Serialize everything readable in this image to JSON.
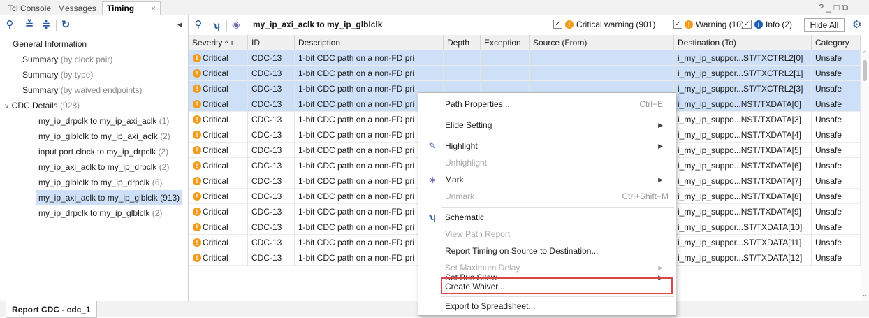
{
  "tabs": [
    {
      "label": "Tcl Console"
    },
    {
      "label": "Messages"
    },
    {
      "label": "Timing"
    }
  ],
  "window_controls": "? _ □ ⧉",
  "left_nav": {
    "general": "General Information",
    "summary1": {
      "main": "Summary",
      "muted": "(by clock pair)"
    },
    "summary2": {
      "main": "Summary",
      "muted": "(by type)"
    },
    "summary3": {
      "main": "Summary",
      "muted": "(by waived endpoints)"
    },
    "cdc": {
      "main": "CDC Details",
      "muted": "(928)"
    },
    "items": [
      {
        "main": "my_ip_drpclk to my_ip_axi_aclk",
        "muted": "(1)"
      },
      {
        "main": "my_ip_glblclk to my_ip_axi_aclk",
        "muted": "(2)"
      },
      {
        "main": "input port clock to my_ip_drpclk",
        "muted": "(2)"
      },
      {
        "main": "my_ip_axi_aclk to my_ip_drpclk",
        "muted": "(2)"
      },
      {
        "main": "my_ip_glblclk to my_ip_drpclk",
        "muted": "(6)"
      },
      {
        "main": "my_ip_axi_aclk to my_ip_glblclk",
        "muted": "(913)"
      },
      {
        "main": "my_ip_drpclk to my_ip_glblclk",
        "muted": "(2)"
      }
    ]
  },
  "right_toolbar": {
    "path_title": "my_ip_axi_aclk to my_ip_glblclk",
    "critical_label": "Critical warning (901)",
    "warning_label": "Warning (10)",
    "info_label": "Info (2)",
    "hide_all": "Hide All",
    "checked": "✓"
  },
  "table": {
    "headers": {
      "severity": "Severity",
      "sort": "^ 1",
      "id": "ID",
      "description": "Description",
      "depth": "Depth",
      "exception": "Exception",
      "source": "Source (From)",
      "destination": "Destination (To)",
      "category": "Category"
    },
    "rows": [
      {
        "severity": "Critical",
        "id": "CDC-13",
        "description": "1-bit CDC path on a non-FD pri",
        "destination": "i_my_ip_suppor...ST/TXCTRL2[0]",
        "category": "Unsafe",
        "selected": true
      },
      {
        "severity": "Critical",
        "id": "CDC-13",
        "description": "1-bit CDC path on a non-FD pri",
        "destination": "i_my_ip_suppor...ST/TXCTRL2[1]",
        "category": "Unsafe",
        "selected": true
      },
      {
        "severity": "Critical",
        "id": "CDC-13",
        "description": "1-bit CDC path on a non-FD pri",
        "destination": "i_my_ip_suppor...ST/TXCTRL2[3]",
        "category": "Unsafe",
        "selected": true
      },
      {
        "severity": "Critical",
        "id": "CDC-13",
        "description": "1-bit CDC path on a non-FD pri",
        "destination": "i_my_ip_suppo...NST/TXDATA[0]",
        "category": "Unsafe",
        "selected": true
      },
      {
        "severity": "Critical",
        "id": "CDC-13",
        "description": "1-bit CDC path on a non-FD pri",
        "destination": "i_my_ip_suppo...NST/TXDATA[3]",
        "category": "Unsafe",
        "selected": false
      },
      {
        "severity": "Critical",
        "id": "CDC-13",
        "description": "1-bit CDC path on a non-FD pri",
        "destination": "i_my_ip_suppo...NST/TXDATA[4]",
        "category": "Unsafe",
        "selected": false
      },
      {
        "severity": "Critical",
        "id": "CDC-13",
        "description": "1-bit CDC path on a non-FD pri",
        "destination": "i_my_ip_suppo...NST/TXDATA[5]",
        "category": "Unsafe",
        "selected": false
      },
      {
        "severity": "Critical",
        "id": "CDC-13",
        "description": "1-bit CDC path on a non-FD pri",
        "destination": "i_my_ip_suppo...NST/TXDATA[6]",
        "category": "Unsafe",
        "selected": false
      },
      {
        "severity": "Critical",
        "id": "CDC-13",
        "description": "1-bit CDC path on a non-FD pri",
        "destination": "i_my_ip_suppo...NST/TXDATA[7]",
        "category": "Unsafe",
        "selected": false
      },
      {
        "severity": "Critical",
        "id": "CDC-13",
        "description": "1-bit CDC path on a non-FD pri",
        "destination": "i_my_ip_suppo...NST/TXDATA[8]",
        "category": "Unsafe",
        "selected": false
      },
      {
        "severity": "Critical",
        "id": "CDC-13",
        "description": "1-bit CDC path on a non-FD pri",
        "destination": "i_my_ip_suppo...NST/TXDATA[9]",
        "category": "Unsafe",
        "selected": false
      },
      {
        "severity": "Critical",
        "id": "CDC-13",
        "description": "1-bit CDC path on a non-FD pri",
        "destination": "i_my_ip_suppor...ST/TXDATA[10]",
        "category": "Unsafe",
        "selected": false
      },
      {
        "severity": "Critical",
        "id": "CDC-13",
        "description": "1-bit CDC path on a non-FD pri",
        "destination": "i_my_ip_suppor...ST/TXDATA[11]",
        "category": "Unsafe",
        "selected": false
      },
      {
        "severity": "Critical",
        "id": "CDC-13",
        "description": "1-bit CDC path on a non-FD pri",
        "destination": "i_my_ip_suppor...ST/TXDATA[12]",
        "category": "Unsafe",
        "selected": false
      }
    ]
  },
  "context_menu": {
    "path_properties": "Path Properties...",
    "path_properties_sc": "Ctrl+E",
    "elide": "Elide Setting",
    "highlight": "Highlight",
    "unhighlight": "Unhighlight",
    "mark": "Mark",
    "unmark": "Unmark",
    "unmark_sc": "Ctrl+Shift+M",
    "schematic": "Schematic",
    "view_path": "View Path Report",
    "report_timing": "Report Timing on Source to Destination...",
    "set_max_delay": "Set Maximum Delay",
    "set_bus_skew": "Set Bus Skew",
    "create_waiver": "Create Waiver...",
    "export": "Export to Spreadsheet..."
  },
  "bottom_tab": "Report CDC - cdc_1",
  "colors": {
    "accent": "#2a5b9a",
    "critical": "#f29a1a",
    "selected": "#cde0f7",
    "highlight_border": "#d9464a"
  }
}
